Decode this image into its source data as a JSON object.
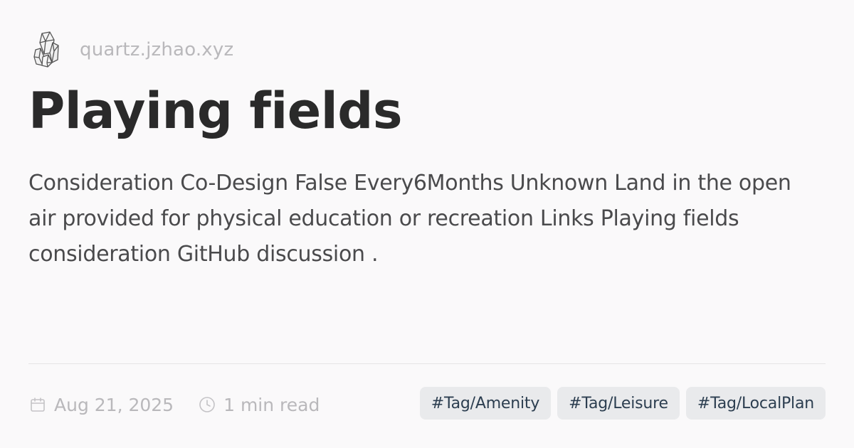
{
  "header": {
    "logo_icon": "crystal-cluster-icon",
    "site_name": "quartz.jzhao.xyz"
  },
  "article": {
    "title": "Playing fields",
    "description": "Consideration Co-Design False Every6Months Unknown Land in the open air provided for physical education or recreation Links Playing fields consideration GitHub discussion ."
  },
  "meta": {
    "date_icon": "calendar-icon",
    "date": "Aug 21, 2025",
    "read_time_icon": "clock-icon",
    "read_time": "1 min read"
  },
  "tags": [
    {
      "label": "#Tag/Amenity"
    },
    {
      "label": "#Tag/Leisure"
    },
    {
      "label": "#Tag/LocalPlan"
    }
  ],
  "colors": {
    "background": "#faf9fa",
    "title": "#2a2a2a",
    "muted": "#b9b8bb",
    "tag_background": "#e9eaec",
    "tag_text": "#2c3e50"
  }
}
